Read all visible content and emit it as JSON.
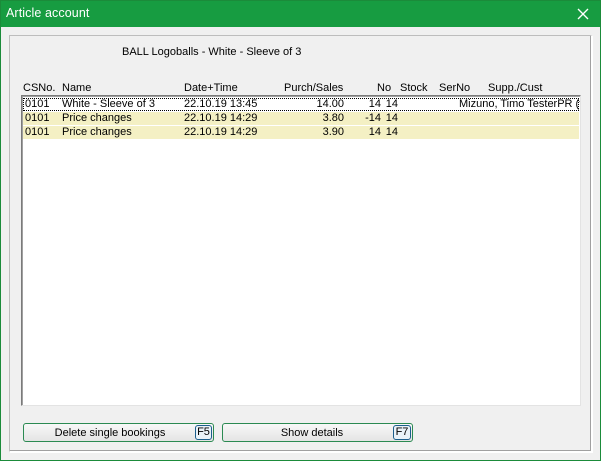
{
  "window": {
    "title": "Article account"
  },
  "article": {
    "heading": "BALL  Logoballs - White - Sleeve of 3"
  },
  "columns": {
    "csno": "CSNo.",
    "name": "Name",
    "datetime": "Date+Time",
    "purch_sales": "Purch/Sales",
    "no": "No",
    "stock": "Stock",
    "serno": "SerNo",
    "supp_cust": "Supp./Cust"
  },
  "rows": [
    {
      "csno": "0101",
      "name": "White - Sleeve of 3",
      "datetime": "22.10.19 13:45",
      "price": "14.00",
      "purch_sales": "14",
      "no": "14",
      "stock": "",
      "serno": "",
      "supp_cust": "Mizuno, Timo TesterPR (t"
    },
    {
      "csno": "0101",
      "name": "Price changes",
      "datetime": "22.10.19 14:29",
      "price": "3.80",
      "purch_sales": "-14",
      "no": "14",
      "stock": "",
      "serno": "",
      "supp_cust": ""
    },
    {
      "csno": "0101",
      "name": "Price changes",
      "datetime": "22.10.19 14:29",
      "price": "3.90",
      "purch_sales": "14",
      "no": "14",
      "stock": "",
      "serno": "",
      "supp_cust": ""
    }
  ],
  "buttons": {
    "delete": {
      "label": "Delete single bookings",
      "key": "F5"
    },
    "details": {
      "label": "Show details",
      "key": "F7"
    }
  },
  "colors": {
    "titlebar": "#179c41",
    "price_row": "#f4f0c4",
    "accent_border": "#2b8a52"
  }
}
